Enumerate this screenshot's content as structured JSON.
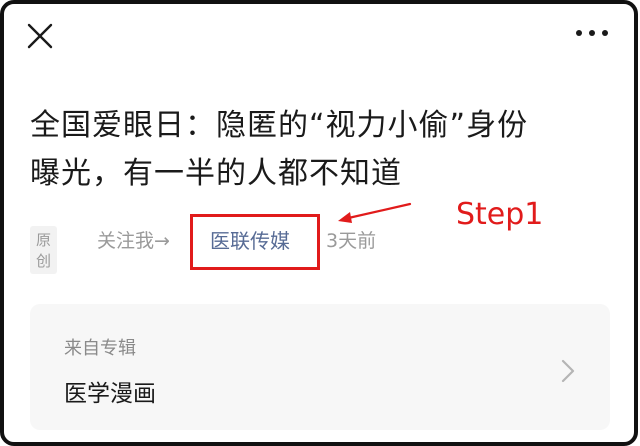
{
  "icons": {
    "close": "close-icon",
    "more": "more-icon",
    "chevron": "chevron-right-icon"
  },
  "article": {
    "title_line1": "全国爱眼日：隐匿的“视力小偷”身份",
    "title_line2": "曝光，有一半的人都不知道",
    "badge": "原创",
    "follow": "关注我→",
    "author": "医联传媒",
    "time": "3天前"
  },
  "annotation": {
    "label": "Step1",
    "color": "#e11b1b"
  },
  "album": {
    "label": "来自专辑",
    "name": "医学漫画"
  },
  "colors": {
    "link": "#576b95",
    "muted": "#9a9a9a",
    "card_bg": "#f7f7f7"
  }
}
